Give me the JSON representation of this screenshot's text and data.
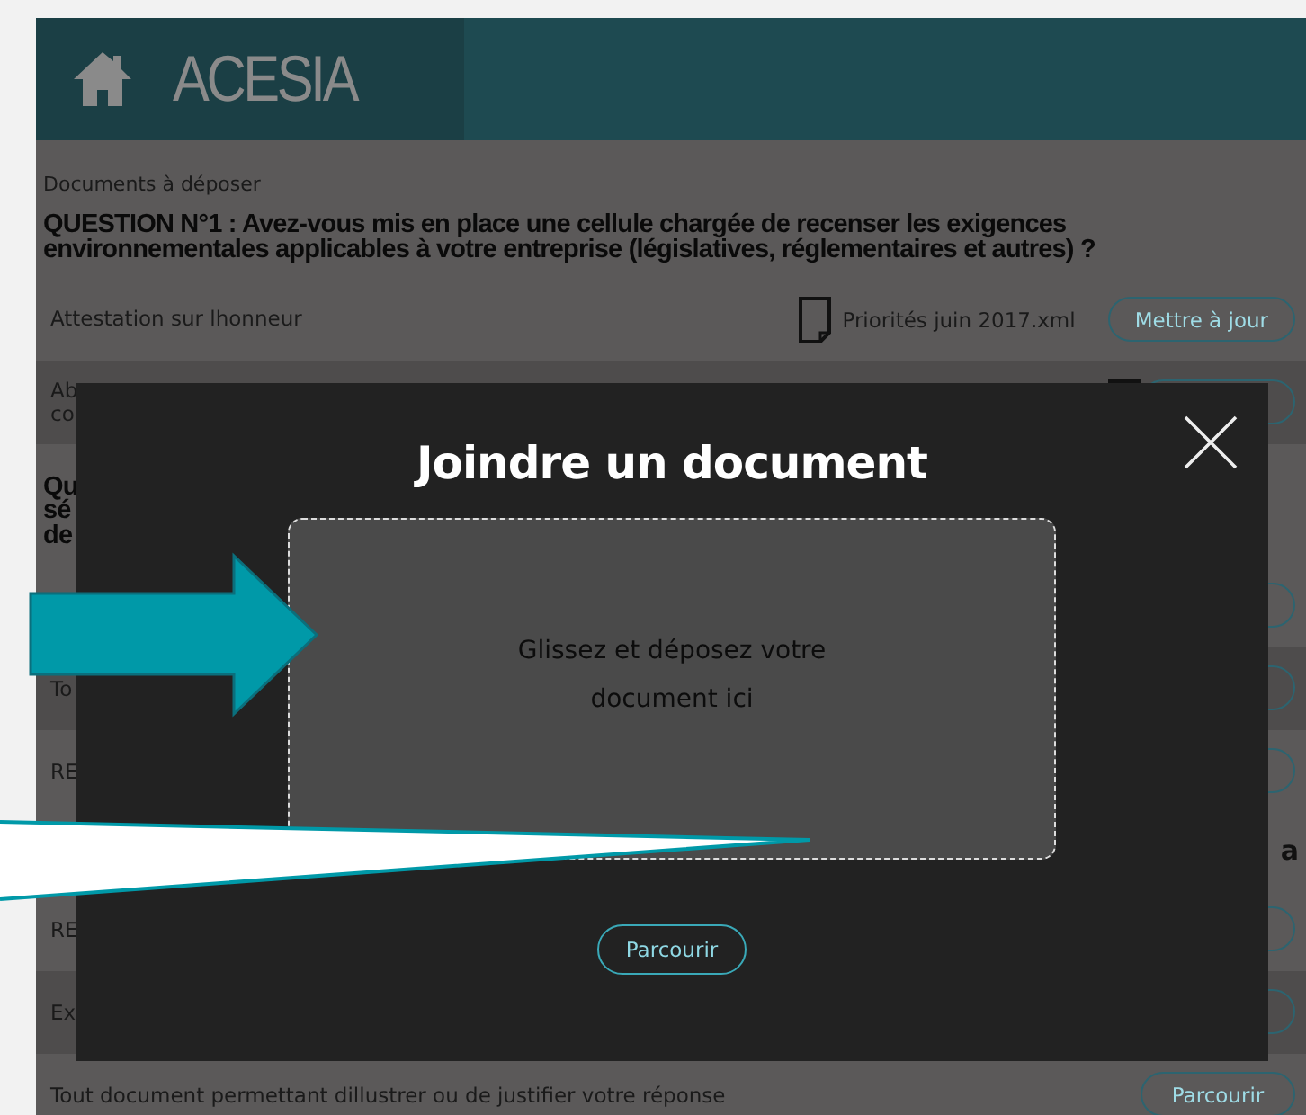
{
  "header": {
    "logo": "ACESIA"
  },
  "heading": "Documents à déposer",
  "rows": [
    {
      "kind": "question",
      "text": "QUESTION N°1 : Avez-vous mis en place une cellule chargée de recenser les exigences environnementales applicables à votre entreprise (législatives, réglementaires et autres) ?"
    },
    {
      "kind": "document",
      "label": "Attestation sur lhonneur",
      "file": "Priorités juin 2017.xml",
      "button": "Mettre à jour",
      "shaded": false
    },
    {
      "kind": "document",
      "label": "Ab\nco",
      "file_icon": true,
      "shaded": true
    },
    {
      "kind": "question",
      "text": "Qu\nsé\nde"
    },
    {
      "kind": "document",
      "shaded": false
    },
    {
      "kind": "document",
      "label": "To",
      "shaded": true
    },
    {
      "kind": "document",
      "label": "RE",
      "shaded": false
    },
    {
      "kind": "question_tail",
      "text": "a"
    },
    {
      "kind": "document",
      "label": "RE",
      "shaded": false
    },
    {
      "kind": "document",
      "label": "Ex",
      "shaded": true
    },
    {
      "kind": "document",
      "label": "Tout document permettant dillustrer ou de justifier votre réponse",
      "button": "Parcourir",
      "shaded": false
    }
  ],
  "modal": {
    "title": "Joindre un document",
    "drop_text": "Glissez et déposez votre document ici",
    "button": "Parcourir"
  }
}
